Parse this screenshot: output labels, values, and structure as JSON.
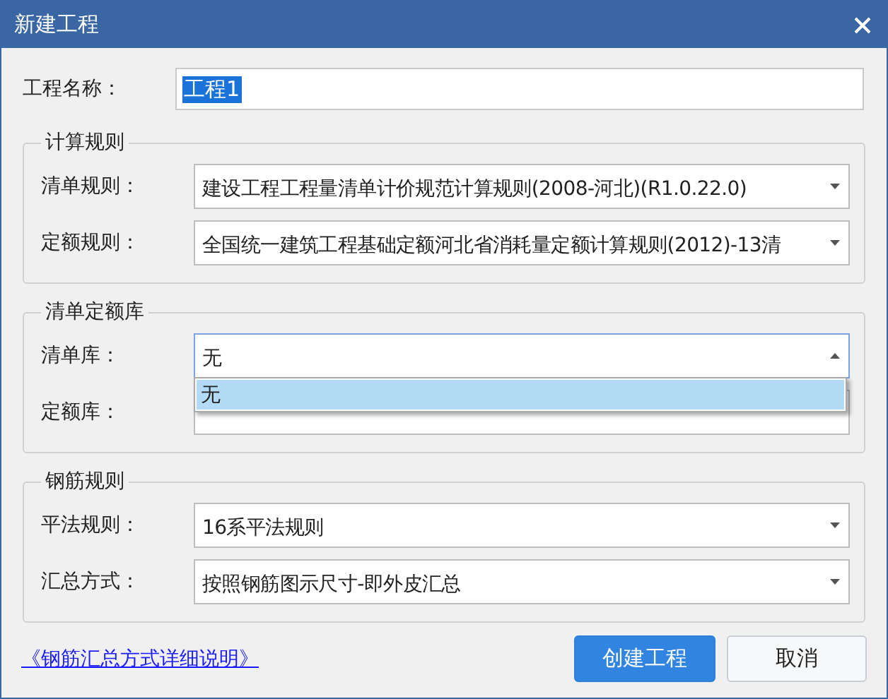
{
  "window": {
    "title": "新建工程"
  },
  "project_name": {
    "label": "工程名称：",
    "value": "工程1",
    "highlighted": true
  },
  "groups": [
    {
      "title": "计算规则",
      "rows": [
        {
          "label": "清单规则：",
          "value": "建设工程工程量清单计价规范计算规则(2008-河北)(R1.0.22.0)",
          "open": false
        },
        {
          "label": "定额规则：",
          "value": "全国统一建筑工程基础定额河北省消耗量定额计算规则(2012)-13清",
          "open": false
        }
      ]
    },
    {
      "title": "清单定额库",
      "rows": [
        {
          "label": "清单库：",
          "value": "无",
          "open": true,
          "options": [
            {
              "label": "无",
              "selected": true
            }
          ]
        },
        {
          "label": "定额库：",
          "open": false
        }
      ]
    },
    {
      "title": "钢筋规则",
      "rows": [
        {
          "label": "平法规则：",
          "value": "16系平法规则",
          "open": false
        },
        {
          "label": "汇总方式：",
          "value": "按照钢筋图示尺寸-即外皮汇总",
          "open": false
        }
      ]
    }
  ],
  "footer": {
    "link": "《钢筋汇总方式详细说明》",
    "buttons": [
      {
        "label": "创建工程",
        "primary": true
      },
      {
        "label": "取消",
        "primary": false
      }
    ]
  }
}
